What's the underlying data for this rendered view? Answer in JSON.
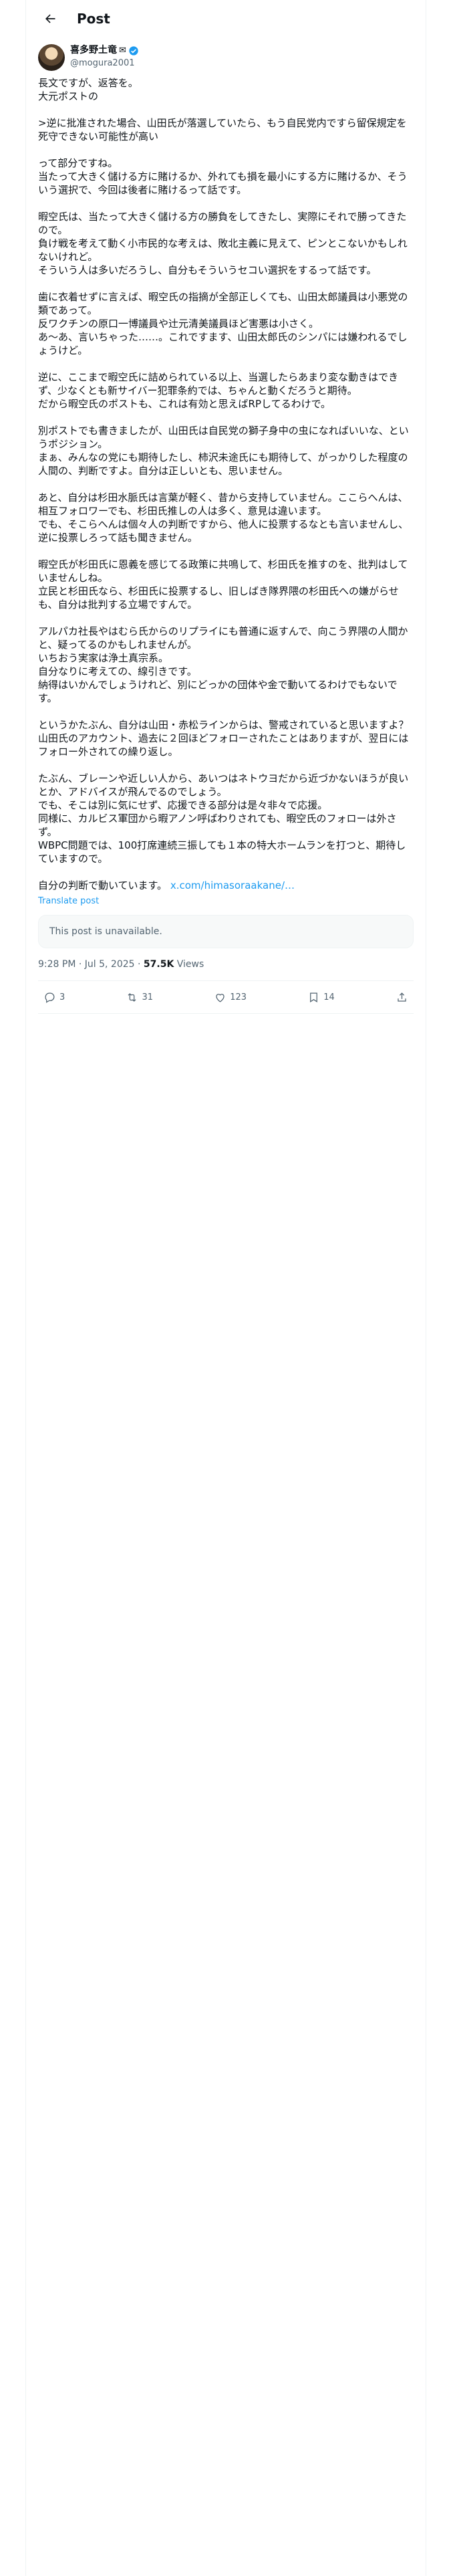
{
  "header": {
    "title": "Post"
  },
  "author": {
    "name": "喜多野土竜",
    "handle": "@mogura2001"
  },
  "tweet": {
    "body": "長文ですが、返答を。\n大元ポストの\n\n>逆に批准された場合、山田氏が落選していたら、もう自民党内ですら留保規定を死守できない可能性が高い\n\nって部分ですね。\n当たって大きく儲ける方に賭けるか、外れても損を最小にする方に賭けるか、そういう選択で、今回は後者に賭けるって話です。\n\n暇空氏は、当たって大きく儲ける方の勝負をしてきたし、実際にそれで勝ってきたので。\n負け戦を考えて動く小市民的な考えは、敗北主義に見えて、ピンとこないかもしれないけれど。\nそういう人は多いだろうし、自分もそういうセコい選択をするって話です。\n\n歯に衣着せずに言えば、暇空氏の指摘が全部正しくても、山田太郎議員は小悪党の類であって。\n反ワクチンの原口一博議員や辻元清美議員ほど害悪は小さく。\nあ〜あ、言いちゃった……。これですます、山田太郎氏のシンパには嫌われるでしょうけど。\n\n逆に、ここまで暇空氏に詰められている以上、当選したらあまり変な動きはできず、少なくとも新サイバー犯罪条約では、ちゃんと動くだろうと期待。\nだから暇空氏のポストも、これは有効と思えばRPしてるわけで。\n\n別ポストでも書きましたが、山田氏は自民党の獅子身中の虫になればいいな、というポジション。\nまぁ、みんなの党にも期待したし、柿沢未途氏にも期待して、がっかりした程度の人間の、判断ですよ。自分は正しいとも、思いません。\n\nあと、自分は杉田水脈氏は言葉が軽く、昔から支持していません。ここらへんは、相互フォロワーでも、杉田氏推しの人は多く、意見は違います。\nでも、そこらへんは個々人の判断ですから、他人に投票するなとも言いませんし、逆に投票しろって話も聞きません。\n\n暇空氏が杉田氏に恩義を感じてる政策に共鳴して、杉田氏を推すのを、批判はしていませんしね。\n立民と杉田氏なら、杉田氏に投票するし、旧しばき隊界隈の杉田氏への嫌がらせも、自分は批判する立場ですんで。\n\nアルパカ社長やはむら氏からのリプライにも普通に返すんで、向こう界隈の人間かと、疑ってるのかもしれませんが。\nいちおう実家は浄土真宗系。\n自分なりに考えての、線引きです。\n納得はいかんでしょうけれど、別にどっかの団体や金で動いてるわけでもないです。\n\nというかたぶん、自分は山田・赤松ラインからは、警戒されていると思いますよ？\n山田氏のアカウント、過去に２回ほどフォローされたことはありますが、翌日にはフォロー外されての繰り返し。\n\nたぶん、ブレーンや近しい人から、あいつはネトウヨだから近づかないほうが良いとか、アドバイスが飛んでるのでしょう。\nでも、そこは別に気にせず、応援できる部分は是々非々で応援。\n同様に、カルビス軍団から暇アノン呼ばわりされても、暇空氏のフォローは外さず。\nWBPC問題では、100打席連続三振しても１本の特大ホームランを打つと、期待していますので。\n\n自分の判断で動いています。",
    "link_text": "x.com/himasoraakane/…",
    "translate": "Translate post",
    "quote_unavailable": "This post is unavailable.",
    "time": "9:28 PM · Jul 5, 2025",
    "dot": " · ",
    "views_count": "57.5K",
    "views_label": " Views"
  },
  "actions": {
    "replies": "3",
    "reposts": "31",
    "likes": "123",
    "bookmarks": "14"
  },
  "colors": {
    "accent": "#1d9bf0",
    "text": "#0f1419",
    "muted": "#536471"
  },
  "icons": [
    "back-arrow-icon",
    "mail-icon",
    "verified-badge-icon",
    "reply-icon",
    "repost-icon",
    "like-icon",
    "bookmark-icon",
    "share-icon"
  ]
}
